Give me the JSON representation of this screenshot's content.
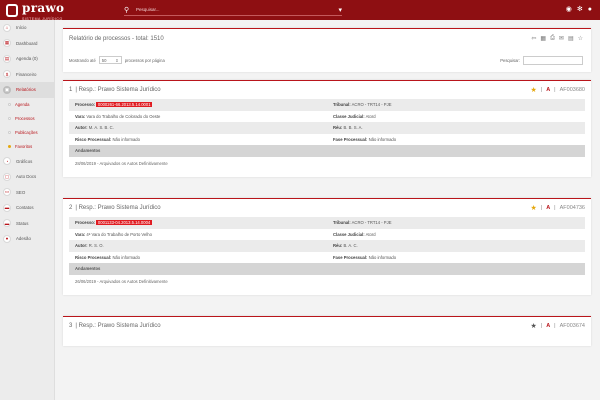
{
  "topbar": {
    "logo_text": "prawo",
    "logo_sub": "SISTEMA JURÍDICO",
    "search_placeholder": "Pesquisar..."
  },
  "sidebar": {
    "items": [
      {
        "label": "Início",
        "icon": "home-icon",
        "glyph": "⌂"
      },
      {
        "label": "Dashboard",
        "icon": "dashboard-icon",
        "glyph": "▦"
      },
      {
        "label": "Agenda (0)",
        "icon": "calendar-icon",
        "glyph": "▤"
      },
      {
        "label": "Financeiro",
        "icon": "dollar-icon",
        "glyph": "$"
      },
      {
        "label": "Relatórios",
        "icon": "reports-icon",
        "glyph": "▣"
      }
    ],
    "subitems": [
      {
        "label": "Agenda"
      },
      {
        "label": "Processos"
      },
      {
        "label": "Publicações"
      },
      {
        "label": "Favoritos"
      }
    ],
    "items2": [
      {
        "label": "Gráficos",
        "icon": "chart-icon",
        "glyph": "◔"
      },
      {
        "label": "Auto Docs",
        "icon": "doc-icon",
        "glyph": "▢"
      },
      {
        "label": "SEO",
        "icon": "seo-icon",
        "glyph": "▭"
      },
      {
        "label": "Contatos",
        "icon": "contacts-icon",
        "glyph": "▬"
      },
      {
        "label": "Status",
        "icon": "status-icon",
        "glyph": "▬"
      },
      {
        "label": "Adesão",
        "icon": "membership-icon",
        "glyph": "●"
      }
    ]
  },
  "report": {
    "title": "Relatório de processos - total: 1510",
    "show_label": "Mostrando até",
    "show_value": "50",
    "show_suffix": "processos por página",
    "search_label": "Pesquisar:"
  },
  "cards": [
    {
      "number": "1",
      "resp": "Resp.: Prawo Sistema Jurídico",
      "code": "AF003680",
      "starred": true,
      "processo_label": "Processo:",
      "processo": "0000261-66.2013.5.14.0001",
      "tribunal_label": "Tribunal:",
      "tribunal": "ACRO - TRT14 - PJE",
      "vara_label": "Vara:",
      "vara": "Vara do Trabalho de Colorado do Oeste",
      "classe_label": "Classe Judicial:",
      "classe": "Atord",
      "autor_label": "Autor:",
      "autor": "M. A. S. B. C.",
      "reu_label": "Réu:",
      "reu": "B. B. S. A.",
      "risco_label": "Risco Processual:",
      "risco": "Não informado",
      "fase_label": "Fase Processual:",
      "fase": "Não informado",
      "andamentos_label": "Andamentos",
      "andamento": "28/06/2019 - Arquivados os Autos Definitivamente"
    },
    {
      "number": "2",
      "resp": "Resp.: Prawo Sistema Jurídico",
      "code": "AF004736",
      "starred": true,
      "processo_label": "Processo:",
      "processo": "0001133-04.2013.5.14.0004",
      "tribunal_label": "Tribunal:",
      "tribunal": "ACRO - TRT14 - PJE",
      "vara_label": "Vara:",
      "vara": "4ª Vara do Trabalho de Porto Velho",
      "classe_label": "Classe Judicial:",
      "classe": "Atord",
      "autor_label": "Autor:",
      "autor": "R. S. O.",
      "reu_label": "Réu:",
      "reu": "B. A. C.",
      "risco_label": "Risco Processual:",
      "risco": "Não informado",
      "fase_label": "Fase Processual:",
      "fase": "Não informado",
      "andamentos_label": "Andamentos",
      "andamento": "26/06/2019 - Arquivados os Autos Definitivamente"
    },
    {
      "number": "3",
      "resp": "Resp.: Prawo Sistema Jurídico",
      "code": "AF003674",
      "starred": false
    }
  ],
  "colors": {
    "brand": "#8e0f12",
    "accent": "#b9151b",
    "star": "#e5a80f",
    "highlight": "#e01c22"
  }
}
